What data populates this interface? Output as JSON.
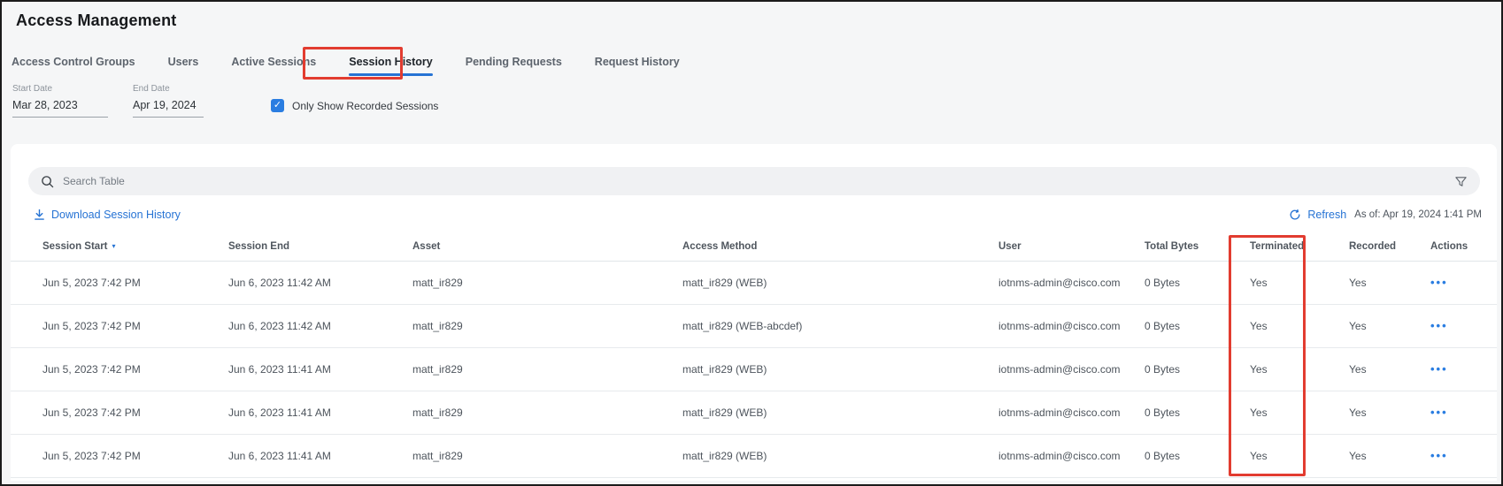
{
  "page": {
    "title": "Access Management"
  },
  "tabs": [
    {
      "label": "Access Control Groups",
      "active": false
    },
    {
      "label": "Users",
      "active": false
    },
    {
      "label": "Active Sessions",
      "active": false
    },
    {
      "label": "Session History",
      "active": true
    },
    {
      "label": "Pending Requests",
      "active": false
    },
    {
      "label": "Request History",
      "active": false
    }
  ],
  "filters": {
    "start_date": {
      "label": "Start Date",
      "value": "Mar 28, 2023"
    },
    "end_date": {
      "label": "End Date",
      "value": "Apr 19, 2024"
    },
    "recorded_checkbox": {
      "label": "Only Show Recorded Sessions",
      "checked": true,
      "checkmark": "✓"
    }
  },
  "table_card": {
    "search": {
      "placeholder": "Search Table"
    },
    "download_label": "Download Session History",
    "refresh_label": "Refresh",
    "as_of": "As of: Apr 19, 2024 1:41 PM",
    "sort": {
      "column": "Session Start",
      "direction": "desc",
      "caret": "▾"
    },
    "columns": [
      "Session Start",
      "Session End",
      "Asset",
      "Access Method",
      "User",
      "Total Bytes",
      "Terminated",
      "Recorded",
      "Actions"
    ],
    "actions_glyph": "•••",
    "rows": [
      {
        "session_start": "Jun 5, 2023 7:42 PM",
        "session_end": "Jun 6, 2023 11:42 AM",
        "asset": "matt_ir829",
        "access_method": "matt_ir829 (WEB)",
        "user": "iotnms-admin@cisco.com",
        "total_bytes": "0 Bytes",
        "terminated": "Yes",
        "recorded": "Yes"
      },
      {
        "session_start": "Jun 5, 2023 7:42 PM",
        "session_end": "Jun 6, 2023 11:42 AM",
        "asset": "matt_ir829",
        "access_method": "matt_ir829 (WEB-abcdef)",
        "user": "iotnms-admin@cisco.com",
        "total_bytes": "0 Bytes",
        "terminated": "Yes",
        "recorded": "Yes"
      },
      {
        "session_start": "Jun 5, 2023 7:42 PM",
        "session_end": "Jun 6, 2023 11:41 AM",
        "asset": "matt_ir829",
        "access_method": "matt_ir829 (WEB)",
        "user": "iotnms-admin@cisco.com",
        "total_bytes": "0 Bytes",
        "terminated": "Yes",
        "recorded": "Yes"
      },
      {
        "session_start": "Jun 5, 2023 7:42 PM",
        "session_end": "Jun 6, 2023 11:41 AM",
        "asset": "matt_ir829",
        "access_method": "matt_ir829 (WEB)",
        "user": "iotnms-admin@cisco.com",
        "total_bytes": "0 Bytes",
        "terminated": "Yes",
        "recorded": "Yes"
      },
      {
        "session_start": "Jun 5, 2023 7:42 PM",
        "session_end": "Jun 6, 2023 11:41 AM",
        "asset": "matt_ir829",
        "access_method": "matt_ir829 (WEB)",
        "user": "iotnms-admin@cisco.com",
        "total_bytes": "0 Bytes",
        "terminated": "Yes",
        "recorded": "Yes"
      }
    ]
  },
  "annotations": {
    "highlight_color": "#e23c30",
    "highlighted_tab": "Session History",
    "highlighted_column": "Terminated"
  },
  "colors": {
    "accent_blue": "#2673d4",
    "checkbox_blue": "#2a7de1",
    "card_bg": "#ffffff",
    "page_bg": "#f5f6f7",
    "highlight_red": "#e23c30"
  }
}
